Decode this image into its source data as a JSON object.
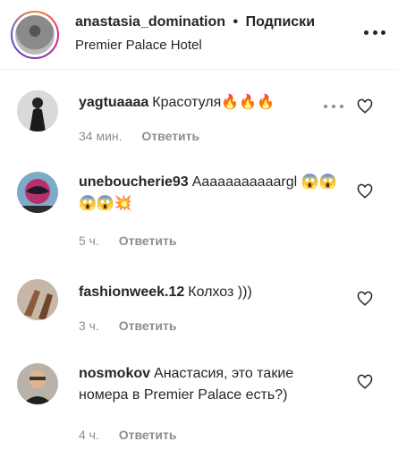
{
  "post": {
    "username": "anastasia_domination",
    "separator": "•",
    "follow_label": "Подписки",
    "location": "Premier Palace Hotel"
  },
  "icons": {
    "more": "more-options-icon",
    "like": "heart-outline-icon"
  },
  "comments": [
    {
      "username": "yagtuaaaa",
      "text": "Красотуля🔥🔥🔥",
      "time": "34 мин.",
      "reply_label": "Ответить"
    },
    {
      "username": "uneboucherie93",
      "text": "Aaaaaaaaaaargl 😱😱😱😱💥",
      "time": "5 ч.",
      "reply_label": "Ответить"
    },
    {
      "username": "fashionweek.12",
      "text": "Колхоз )))",
      "time": "3 ч.",
      "reply_label": "Ответить"
    },
    {
      "username": "nosmokov",
      "text": "Анастасия, это такие номера в Premier Palace есть?)",
      "time": "4 ч.",
      "reply_label": "Ответить"
    }
  ],
  "colors": {
    "text": "#262626",
    "secondary": "#8e8e8e",
    "divider": "#efefef"
  }
}
